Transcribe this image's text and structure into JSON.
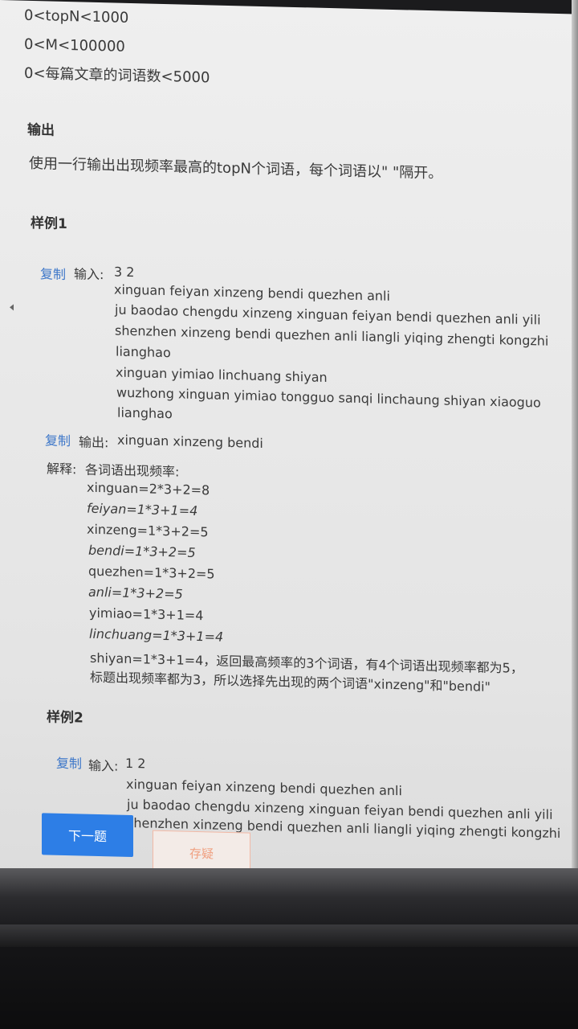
{
  "constraints": [
    "0<topN<1000",
    "0<M<100000",
    "0<每篇文章的词语数<5000"
  ],
  "output_section": {
    "heading": "输出",
    "text": "使用一行输出出现频率最高的topN个词语，每个词语以\" \"隔开。"
  },
  "example1": {
    "heading": "样例1",
    "copy_label": "复制",
    "input_label": "输入:",
    "input_first": "3 2",
    "input_lines": [
      "xinguan feiyan xinzeng bendi quezhen anli",
      "ju baodao chengdu xinzeng xinguan feiyan bendi quezhen anli yili",
      "shenzhen xinzeng bendi quezhen anli liangli yiqing zhengti kongzhi",
      "lianghao",
      "xinguan yimiao linchuang shiyan",
      "wuzhong xinguan yimiao tongguo sanqi linchaung shiyan xiaoguo",
      "lianghao"
    ],
    "output_copy_label": "复制",
    "output_label": "输出:",
    "output_value": "xinguan xinzeng bendi",
    "explain_label": "解释:",
    "explain_intro": "各词语出现频率:",
    "explain_lines": [
      "xinguan=2*3+2=8",
      "feiyan=1*3+1=4",
      "xinzeng=1*3+2=5",
      "bendi=1*3+2=5",
      "quezhen=1*3+2=5",
      "anli=1*3+2=5",
      "yimiao=1*3+1=4",
      "linchuang=1*3+1=4",
      "shiyan=1*3+1=4，返回最高频率的3个词语，有4个词语出现频率都为5，",
      "标题出现频率都为3，所以选择先出现的两个词语\"xinzeng\"和\"bendi\""
    ]
  },
  "example2": {
    "heading": "样例2",
    "copy_label": "复制",
    "input_label": "输入:",
    "input_first": "1 2",
    "input_lines": [
      "xinguan feiyan xinzeng bendi quezhen anli",
      "ju baodao chengdu xinzeng xinguan feiyan bendi quezhen anli yili",
      "shenzhen xinzeng bendi quezhen anli liangli yiqing zhengti kongzhi"
    ]
  },
  "buttons": {
    "next": "下一题",
    "save": "存疑"
  },
  "colors": {
    "accent": "#2d7ee6",
    "link": "#3f78c9",
    "save_border": "#f1b9a6"
  }
}
